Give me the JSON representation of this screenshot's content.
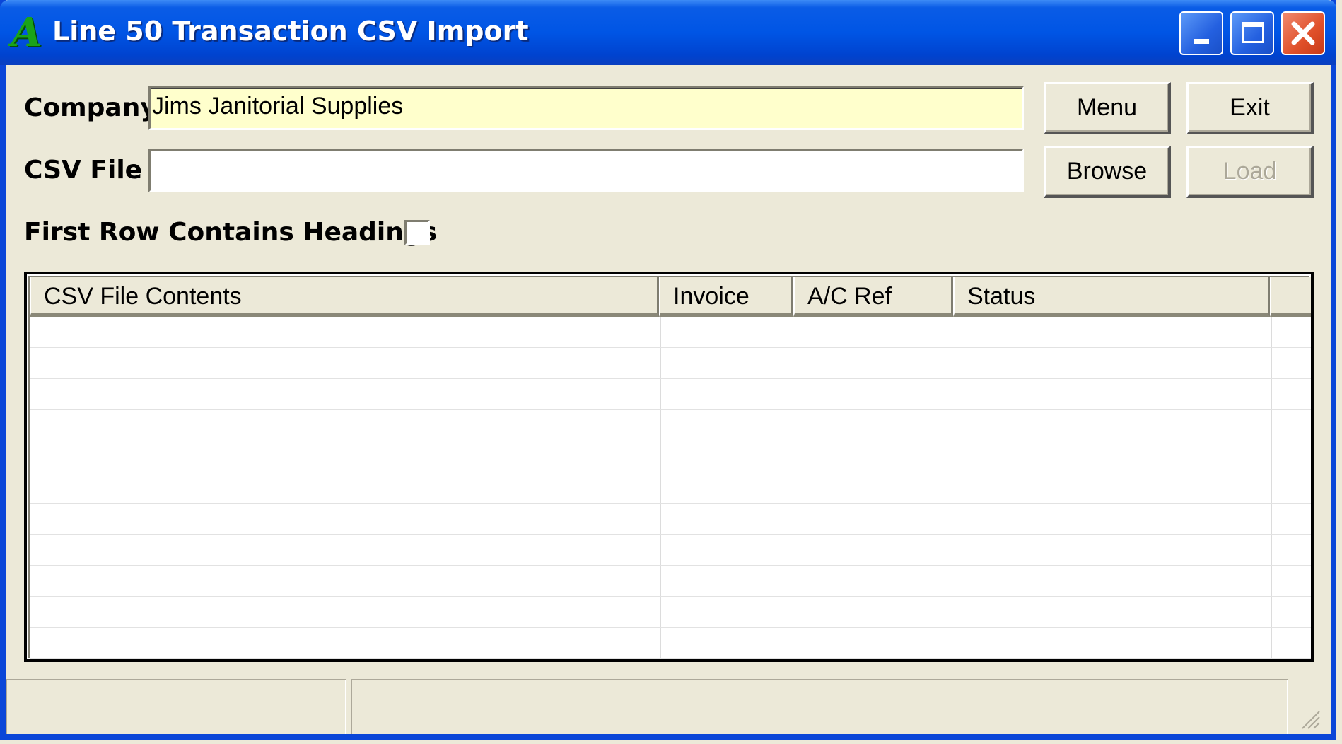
{
  "window": {
    "title": "Line 50 Transaction CSV Import",
    "icon": "app-logo-icon",
    "controls": [
      "minimize-icon",
      "maximize-icon",
      "close-icon"
    ]
  },
  "form": {
    "company_label": "Company",
    "company_value": "Jims Janitorial Supplies",
    "company_bg": "#ffffcc",
    "csv_file_label": "CSV File",
    "csv_file_value": "",
    "headings_label": "First Row Contains Headings",
    "headings_checked": false
  },
  "buttons": {
    "menu": "Menu",
    "exit": "Exit",
    "browse": "Browse",
    "load": "Load",
    "load_enabled": false
  },
  "grid": {
    "columns": [
      "CSV File Contents",
      "Invoice",
      "A/C Ref",
      "Status",
      ""
    ],
    "rows": []
  },
  "status_bar": {
    "panels": [
      "",
      ""
    ]
  }
}
